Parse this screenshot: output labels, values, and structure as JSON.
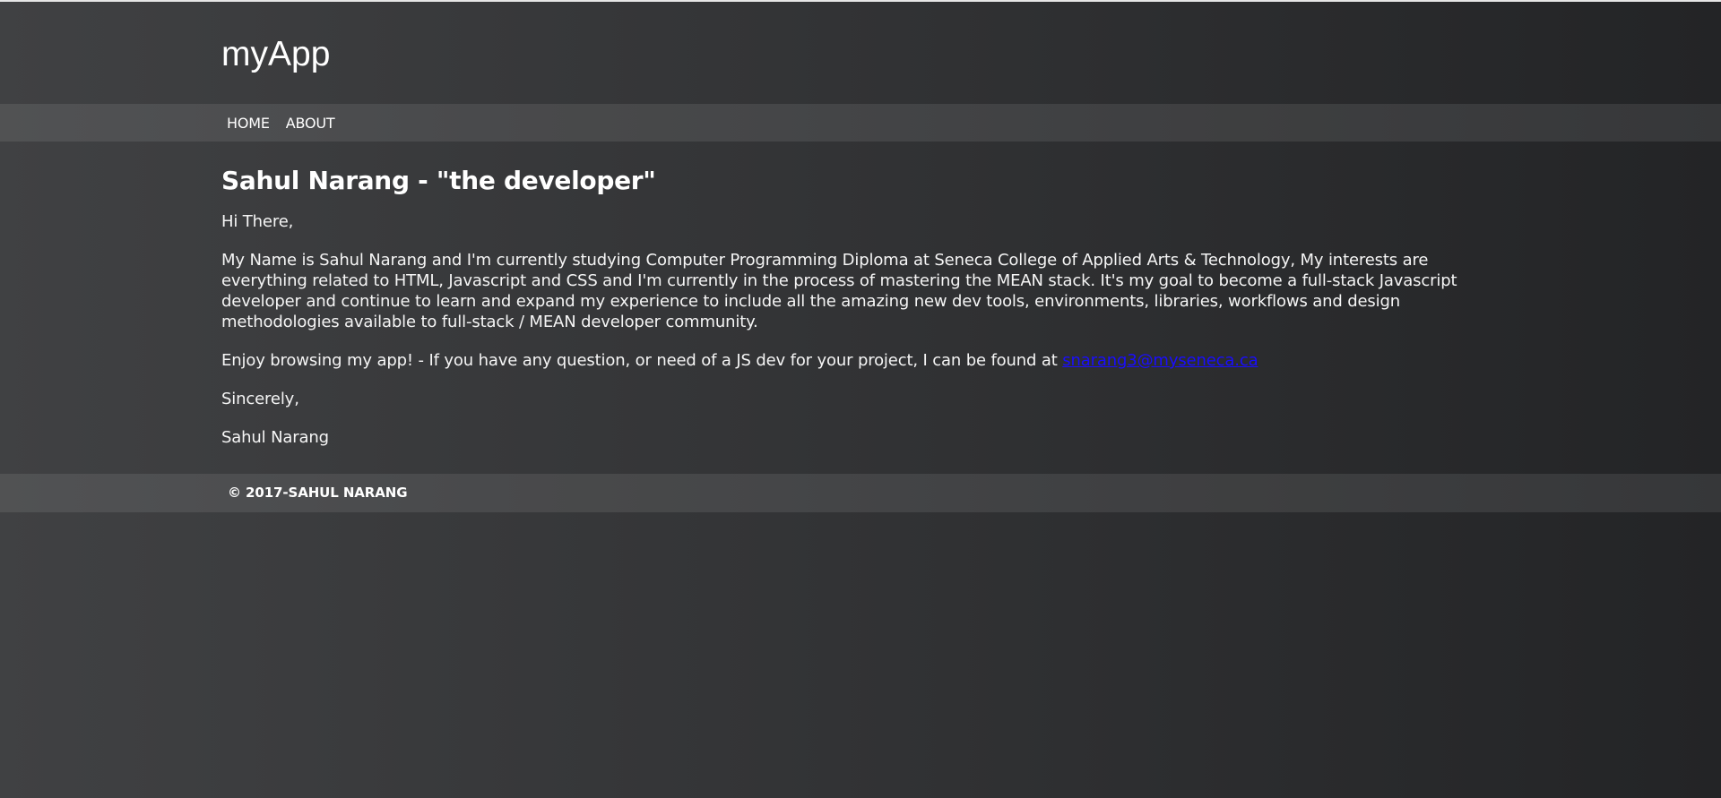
{
  "header": {
    "app_title": "myApp"
  },
  "nav": {
    "items": [
      {
        "label": "HOME"
      },
      {
        "label": "ABOUT"
      }
    ]
  },
  "main": {
    "heading": "Sahul Narang - \"the developer\"",
    "greeting": "Hi There,",
    "intro": "My Name is Sahul Narang and I'm currently studying Computer Programming Diploma at Seneca College of Applied Arts & Technology, My interests are everything related to HTML, Javascript and CSS and I'm currently in the process of mastering the MEAN stack. It's my goal to become a full-stack Javascript developer and continue to learn and expand my experience to include all the amazing new dev tools, environments, libraries, workflows and design methodologies available to full-stack / MEAN developer community.",
    "contact_text": "Enjoy browsing my app! - If you have any question, or need of a JS dev for your project, I can be found at ",
    "contact_email": "snarang3@myseneca.ca",
    "closing": "Sincerely,",
    "signature": "Sahul Narang"
  },
  "footer": {
    "copyright": "© 2017-SAHUL NARANG"
  },
  "colors": {
    "background_left": "#404143",
    "background_right": "#232426",
    "link": "#1a0dff",
    "text": "#ffffff"
  }
}
